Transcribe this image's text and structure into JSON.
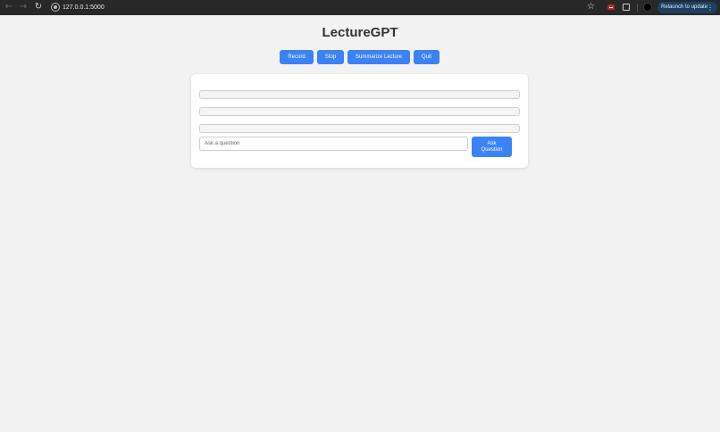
{
  "browser": {
    "url": "127.0.0.1:5000",
    "back_icon": "←",
    "forward_icon": "→",
    "reload_icon": "↻",
    "bookmark_icon": "☆",
    "relaunch_label": "Relaunch to update",
    "menu_icon": "⋮"
  },
  "page": {
    "title": "LectureGPT"
  },
  "controls": {
    "record_label": "Record",
    "stop_label": "Stop",
    "summarize_label": "Summarize Lecture",
    "quit_label": "Quit"
  },
  "qa": {
    "outputs": [
      "",
      "",
      ""
    ],
    "question_placeholder": "Ask a question",
    "question_value": "",
    "ask_label": "Ask Question"
  },
  "colors": {
    "accent": "#3b82f6",
    "background": "#f2f2f2",
    "browser_bar": "#282828",
    "relaunch_bg": "#1d3f63"
  }
}
